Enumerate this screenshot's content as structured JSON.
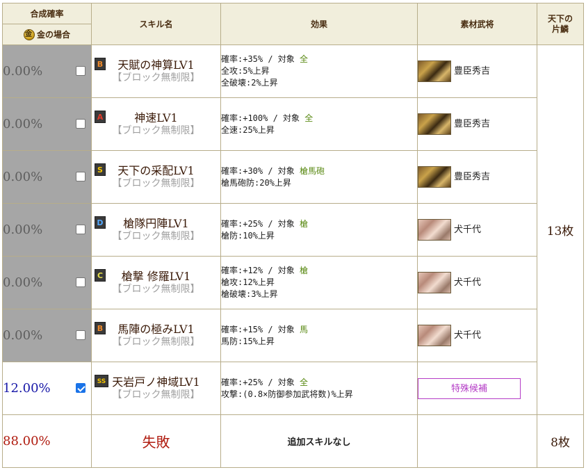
{
  "header": {
    "rate": "合成確率",
    "gold_case": "金の場合",
    "skill_name": "スキル名",
    "effect": "効果",
    "material": "素材武将",
    "scale": "天下の片鱗"
  },
  "rows": [
    {
      "rate": "0.00%",
      "checked": false,
      "rank": "B",
      "name": "天賦の神算LV1",
      "note": "【ブロック無制限】",
      "eff1a": "確率:+35% / 対象 ",
      "eff1b": "全",
      "eff2": "全攻:5%上昇",
      "eff3": "全破壊:2%上昇",
      "mat": "豊臣秀吉"
    },
    {
      "rate": "0.00%",
      "checked": false,
      "rank": "A",
      "name": "神速LV1",
      "note": "【ブロック無制限】",
      "eff1a": "確率:+100% / 対象 ",
      "eff1b": "全",
      "eff2": "全速:25%上昇",
      "eff3": "",
      "mat": "豊臣秀吉"
    },
    {
      "rate": "0.00%",
      "checked": false,
      "rank": "S",
      "name": "天下の采配LV1",
      "note": "【ブロック無制限】",
      "eff1a": "確率:+30% / 対象 ",
      "eff1b": "槍馬砲",
      "eff2": "槍馬砲防:20%上昇",
      "eff3": "",
      "mat": "豊臣秀吉"
    },
    {
      "rate": "0.00%",
      "checked": false,
      "rank": "D",
      "name": "槍隊円陣LV1",
      "note": "【ブロック無制限】",
      "eff1a": "確率:+25% / 対象 ",
      "eff1b": "槍",
      "eff2": "槍防:10%上昇",
      "eff3": "",
      "mat": "犬千代"
    },
    {
      "rate": "0.00%",
      "checked": false,
      "rank": "C",
      "name": "槍撃 修羅LV1",
      "note": "【ブロック無制限】",
      "eff1a": "確率:+12% / 対象 ",
      "eff1b": "槍",
      "eff2": "槍攻:12%上昇",
      "eff3": "槍破壊:3%上昇",
      "mat": "犬千代"
    },
    {
      "rate": "0.00%",
      "checked": false,
      "rank": "B",
      "name": "馬陣の極みLV1",
      "note": "【ブロック無制限】",
      "eff1a": "確率:+15% / 対象 ",
      "eff1b": "馬",
      "eff2": "馬防:15%上昇",
      "eff3": "",
      "mat": "犬千代"
    },
    {
      "rate": "12.00%",
      "checked": true,
      "rank": "SS",
      "name": "天岩戸ノ神域LV1",
      "note": "【ブロック無制限】",
      "eff1a": "確率:+25% / 対象 ",
      "eff1b": "全",
      "eff2": "攻撃:(0.8×防御参加武将数)%上昇",
      "eff3": "",
      "mat_button": "特殊候補"
    }
  ],
  "scale_count": "13枚",
  "result": {
    "rate": "88.00%",
    "label": "失敗",
    "effect": "追加スキルなし",
    "count": "8枚"
  }
}
